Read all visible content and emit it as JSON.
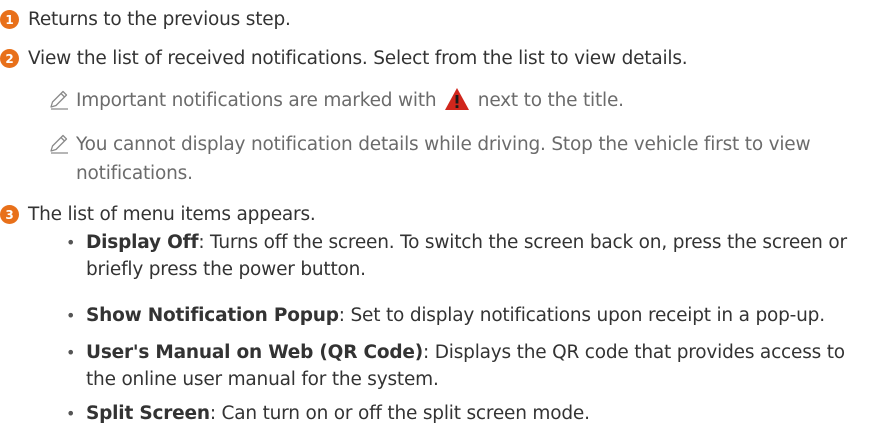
{
  "steps": [
    {
      "number": "1",
      "text": "Returns to the previous step."
    },
    {
      "number": "2",
      "text": "View the list of received notifications. Select from the list to view details."
    },
    {
      "number": "3",
      "text": "The list of menu items appears."
    }
  ],
  "notes": [
    {
      "before": "Important notifications are marked with",
      "after": "next to the title.",
      "icon": "warning-triangle-icon"
    },
    {
      "text": "You cannot display notification details while driving. Stop the vehicle first to view notifications."
    }
  ],
  "menu_items": [
    {
      "term": "Display Off",
      "desc": ": Turns off the screen. To switch the screen back on, press the screen or briefly press the power button."
    },
    {
      "term": "Show Notification Popup",
      "desc": ": Set to display notifications upon receipt in a pop-up."
    },
    {
      "term": "User's Manual on Web (QR Code)",
      "desc": ": Displays the QR code that provides access to the online user manual for the system."
    },
    {
      "term": "Split Screen",
      "desc": ": Can turn on or off the split screen mode."
    }
  ],
  "colors": {
    "step_badge": "#e8701a",
    "warning_icon": "#d0261c",
    "note_text": "#6b6b6b"
  }
}
